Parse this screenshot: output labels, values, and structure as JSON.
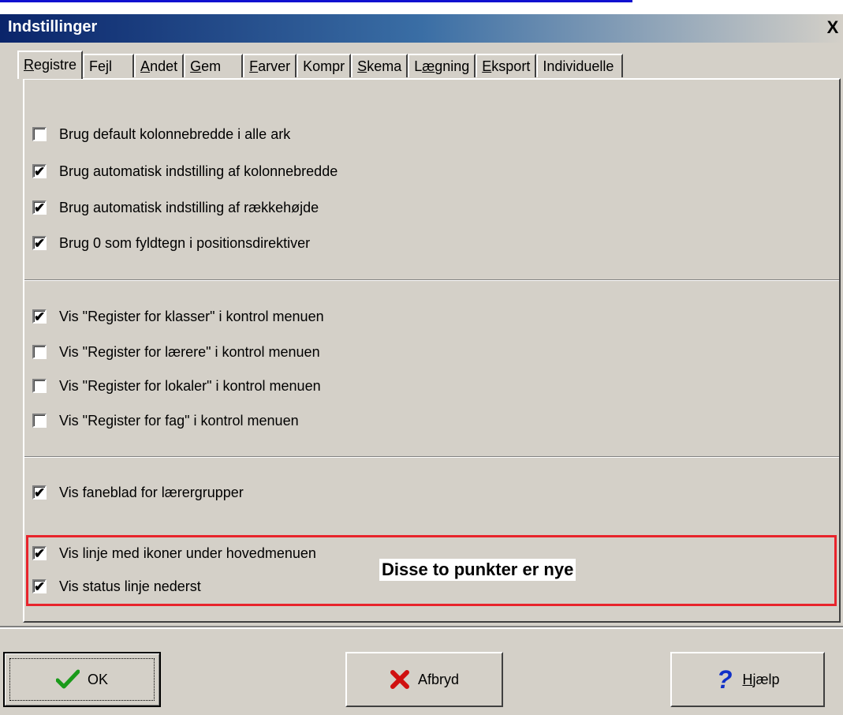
{
  "dialog": {
    "title": "Indstillinger",
    "close_glyph": "X"
  },
  "tabs": [
    {
      "label_u": "R",
      "label_rest": "egistre",
      "active": true
    },
    {
      "label_pre": "Fe",
      "label_u": "j",
      "label_rest": "l"
    },
    {
      "label_u": "A",
      "label_rest": "ndet"
    },
    {
      "label_u": "G",
      "label_rest": "em"
    },
    {
      "label_u": "F",
      "label_rest": "arver"
    },
    {
      "label_pre": "Kompr",
      "label_u": "",
      "label_rest": ""
    },
    {
      "label_u": "S",
      "label_rest": "kema"
    },
    {
      "label_pre": "L",
      "label_u": "æ",
      "label_rest": "gning"
    },
    {
      "label_u": "E",
      "label_rest": "ksport"
    },
    {
      "label_pre": "Individuelle",
      "label_u": "",
      "label_rest": ""
    }
  ],
  "options": {
    "group1": [
      {
        "label": "Brug default kolonnebredde i alle ark",
        "checked": false
      },
      {
        "label": "Brug automatisk indstilling af kolonnebredde",
        "checked": true
      },
      {
        "label": "Brug automatisk indstilling af rækkehøjde",
        "checked": true
      },
      {
        "label": "Brug 0 som fyldtegn i positionsdirektiver",
        "checked": true
      }
    ],
    "group2": [
      {
        "label": "Vis \"Register for klasser\" i kontrol menuen",
        "checked": true
      },
      {
        "label": "Vis \"Register for lærere\" i kontrol menuen",
        "checked": false
      },
      {
        "label": "Vis \"Register for lokaler\" i kontrol menuen",
        "checked": false
      },
      {
        "label": "Vis \"Register for fag\" i kontrol menuen",
        "checked": false
      }
    ],
    "group3": [
      {
        "label": "Vis faneblad for lærergrupper",
        "checked": true
      }
    ],
    "group4": [
      {
        "label": "Vis linje med ikoner under hovedmenuen",
        "checked": true
      },
      {
        "label": "Vis status linje nederst",
        "checked": true
      }
    ]
  },
  "annotation": {
    "note": "Disse to punkter er nye",
    "color": "#e8242c"
  },
  "buttons": {
    "ok": {
      "label": "OK",
      "icon": "checkmark-icon"
    },
    "cancel": {
      "label": "Afbryd",
      "icon": "red-x-icon"
    },
    "help": {
      "label_u": "H",
      "label_rest": "jælp",
      "icon": "question-mark-icon"
    }
  },
  "colors": {
    "face": "#d4d0c8",
    "titlebar_start": "#0a246a",
    "check_green": "#1a9a1a",
    "cancel_red": "#d01010",
    "help_blue": "#1030c8"
  }
}
